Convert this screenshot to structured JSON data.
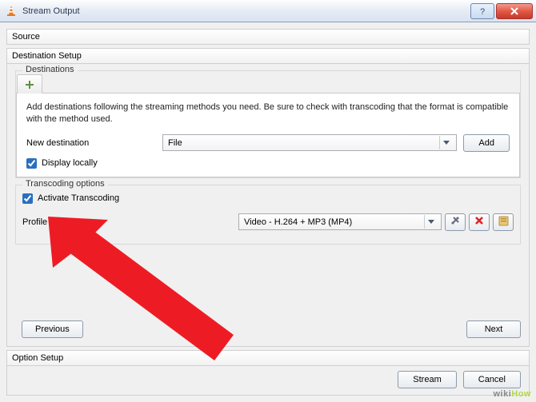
{
  "window": {
    "title": "Stream Output"
  },
  "sections": {
    "source": "Source",
    "destination_setup": "Destination Setup",
    "option_setup": "Option Setup"
  },
  "destinations": {
    "group_title": "Destinations",
    "description": "Add destinations following the streaming methods you need. Be sure to check with transcoding that the format is compatible with the method used.",
    "new_destination_label": "New destination",
    "new_destination_value": "File",
    "add_button": "Add",
    "display_locally_label": "Display locally",
    "display_locally_checked": true
  },
  "transcoding": {
    "group_title": "Transcoding options",
    "activate_label": "Activate Transcoding",
    "activate_checked": true,
    "profile_label": "Profile",
    "profile_value": "Video - H.264 + MP3 (MP4)"
  },
  "nav": {
    "previous": "Previous",
    "next": "Next"
  },
  "footer": {
    "stream": "Stream",
    "cancel": "Cancel"
  },
  "icons": {
    "app": "vlc-cone-icon",
    "help": "help-icon",
    "close": "close-icon",
    "plus": "plus-icon",
    "dropdown": "chevron-down-icon",
    "tools": "tools-icon",
    "delete": "delete-icon",
    "save": "save-profile-icon"
  },
  "watermark": "wikiHow"
}
